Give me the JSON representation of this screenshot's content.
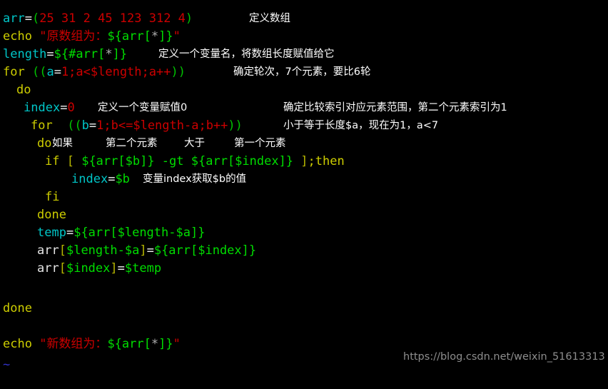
{
  "terminal": {
    "background": "#000000",
    "watermark": "https://blog.csdn.net/weixin_51613313",
    "tilde": "~"
  },
  "colors": {
    "variable": "#00c5c7",
    "number": "#cc0000",
    "keyword": "#cdcd00",
    "substitution": "#00dd00",
    "string": "#cc0000",
    "comment": "#ffffff",
    "paren": "#00c200",
    "bracket": "#b8b800",
    "plain": "#e6e6e6",
    "tilde": "#3333cc",
    "watermark": "#8d8d8d"
  },
  "code": {
    "l1": {
      "name": "arr",
      "eq": "=",
      "open": "(",
      "values": "25 31 2 45 123 312 4",
      "close": ")"
    },
    "l2": {
      "keyword": "echo",
      "quote_open": " \"",
      "text": "原数组为：",
      "subst": "${arr[",
      "star": "*",
      "subst_end": "]}",
      "quote_close": "\""
    },
    "l3": {
      "name": "length",
      "eq": "=",
      "subst": "${#arr[",
      "star": "*",
      "subst_end": "]}"
    },
    "l4": {
      "keyword": "for",
      "open": " ((",
      "var": "a",
      "eq": "=",
      "expr": "1;a<$length;a++",
      "close": "))"
    },
    "l5": {
      "keyword": "do"
    },
    "l6": {
      "name": "index",
      "eq": "=",
      "value": "0"
    },
    "l7": {
      "keyword": "for",
      "open": "  ((",
      "var": "b",
      "eq": "=",
      "expr": "1;b<=$length-a;b++",
      "close": "))"
    },
    "l8": {
      "keyword": "do"
    },
    "l9": {
      "keyword": "if",
      "bracket_open": " [ ",
      "left": "${arr[$b]}",
      "op": " -gt ",
      "right": "${arr[$index]}",
      "bracket_close": " ]",
      "then": ";then"
    },
    "l10": {
      "name": "index",
      "eq": "=",
      "value": "$b"
    },
    "l11": {
      "keyword": "fi"
    },
    "l12": {
      "keyword": "done"
    },
    "l13": {
      "name": "temp",
      "eq": "=",
      "subst": "${arr[$length-$a]}"
    },
    "l14": {
      "name": "arr",
      "br_open": "[",
      "index": "$length-$a",
      "br_close": "]",
      "eq": "=",
      "subst": "${arr[$index]}"
    },
    "l15": {
      "name": "arr",
      "br_open": "[",
      "index": "$index",
      "br_close": "]",
      "eq": "=",
      "subst": "$temp"
    },
    "l16": {
      "keyword": "done"
    },
    "l17": {
      "keyword": "echo",
      "quote_open": " \"",
      "text": "新数组为：",
      "subst": "${arr[",
      "star": "*",
      "subst_end": "]}",
      "quote_close": "\""
    }
  },
  "comments": {
    "c1": "定义数组",
    "c2": "定义一个变量名，将数组长度赋值给它",
    "c3": "确定轮次，7个元素，要比6轮",
    "c4": "定义一个变量赋值0",
    "c5": "确定比较索引对应元素范围，第二个元素索引为1",
    "c6": "小于等于长度$a，现在为1，a<7",
    "c7": "如果",
    "c8": "第二个元素",
    "c9": "大于",
    "c10": "第一个元素",
    "c11": "变量index获取$b的值"
  }
}
